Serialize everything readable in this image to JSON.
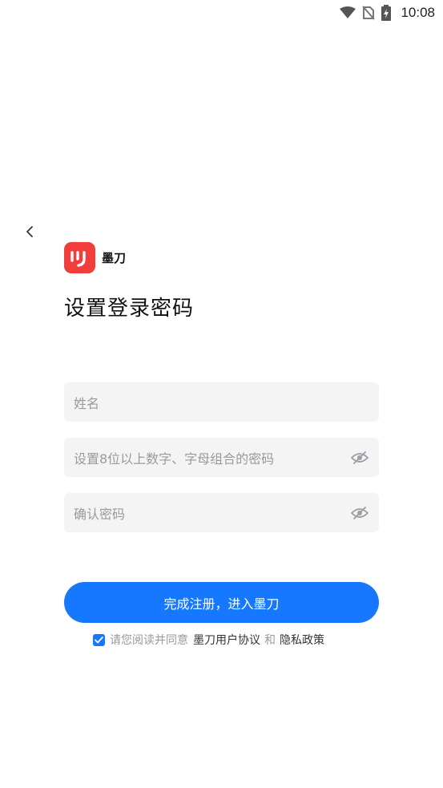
{
  "status_bar": {
    "time": "10:08",
    "icons": [
      "wifi-icon",
      "no-sim-icon",
      "battery-charging-icon"
    ]
  },
  "nav": {
    "back_icon": "chevron-left-icon"
  },
  "brand": {
    "name": "墨刀",
    "logo_icon": "modao-logo-icon",
    "logo_color": "#f23d3d"
  },
  "page": {
    "title": "设置登录密码"
  },
  "form": {
    "name_placeholder": "姓名",
    "password_placeholder": "设置8位以上数字、字母组合的密码",
    "confirm_placeholder": "确认密码",
    "eye_icon": "eye-off-icon"
  },
  "submit": {
    "label": "完成注册，进入墨刀",
    "color": "#1677ff"
  },
  "agreement": {
    "checked": true,
    "prefix": "请您阅读并同意",
    "user_agreement": "墨刀用户协议",
    "and": "和",
    "privacy_policy": "隐私政策"
  }
}
